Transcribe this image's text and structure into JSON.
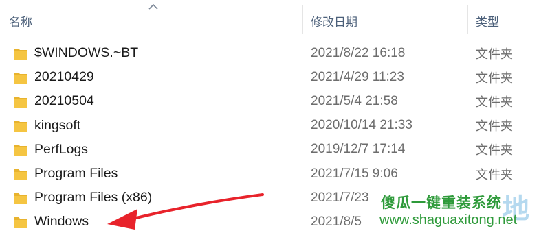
{
  "columns": {
    "name": "名称",
    "date": "修改日期",
    "type": "类型"
  },
  "rows": [
    {
      "name": "$WINDOWS.~BT",
      "date": "2021/8/22 16:18",
      "type": "文件夹"
    },
    {
      "name": "20210429",
      "date": "2021/4/29 11:23",
      "type": "文件夹"
    },
    {
      "name": "20210504",
      "date": "2021/5/4 21:58",
      "type": "文件夹"
    },
    {
      "name": "kingsoft",
      "date": "2020/10/14 21:33",
      "type": "文件夹"
    },
    {
      "name": "PerfLogs",
      "date": "2019/12/7 17:14",
      "type": "文件夹"
    },
    {
      "name": "Program Files",
      "date": "2021/7/15 9:06",
      "type": "文件夹"
    },
    {
      "name": "Program Files (x86)",
      "date": "2021/7/23",
      "type": ""
    },
    {
      "name": "Windows",
      "date": "2021/8/5",
      "type": ""
    }
  ],
  "watermark": {
    "title": "傻瓜一键重装系统",
    "url": "www.shaguaxitong.net",
    "big": "地"
  },
  "colors": {
    "arrow": "#e8232b",
    "folder": "#f5c542",
    "watermark_green": "#2e9a3a"
  },
  "icons": {
    "sort": "chevron-up-icon",
    "folder": "folder-icon"
  }
}
